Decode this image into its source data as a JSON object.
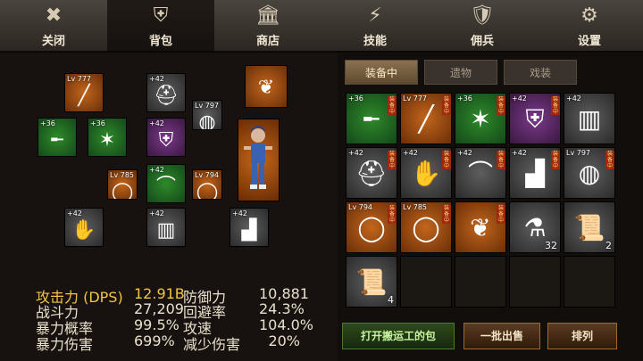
{
  "tabs": [
    {
      "label": "关闭",
      "icon": "close-icon",
      "glyph": "✖"
    },
    {
      "label": "背包",
      "icon": "armor-icon",
      "glyph": "⛨"
    },
    {
      "label": "商店",
      "icon": "bank-icon",
      "glyph": "🏛"
    },
    {
      "label": "技能",
      "icon": "lightning-icon",
      "glyph": "⚡"
    },
    {
      "label": "佣兵",
      "icon": "shield-icon",
      "glyph": "🛡"
    },
    {
      "label": "设置",
      "icon": "gear-icon",
      "glyph": "⚙"
    }
  ],
  "inventory_tabs": [
    "装备中",
    "遗物",
    "戏装"
  ],
  "equipment": [
    {
      "lv": "Lv 777",
      "icon": "staff-icon",
      "glyph": "╱",
      "color": "orange"
    },
    {
      "lv": "+42",
      "icon": "helmet-icon",
      "glyph": "⛑",
      "color": "gray"
    },
    {
      "lv": "",
      "icon": "wings-icon",
      "glyph": "❦",
      "color": "orange"
    },
    {
      "lv": "+36",
      "icon": "gun-icon",
      "glyph": "╾",
      "color": "green"
    },
    {
      "lv": "+36",
      "icon": "mace-icon",
      "glyph": "✶",
      "color": "green"
    },
    {
      "lv": "+42",
      "icon": "chest-armor-icon",
      "glyph": "⛨",
      "color": "purple"
    },
    {
      "lv": "Lv 797",
      "icon": "bracer-icon",
      "glyph": "◍",
      "color": "gray"
    },
    {
      "lv": "Lv 785",
      "icon": "ring-icon",
      "glyph": "◯",
      "color": "orange"
    },
    {
      "lv": "+42",
      "icon": "shoulder-icon",
      "glyph": "⌒",
      "color": "green"
    },
    {
      "lv": "Lv 794",
      "icon": "ring-icon",
      "glyph": "◯",
      "color": "orange"
    },
    {
      "lv": "+42",
      "icon": "gauntlet-icon",
      "glyph": "✋",
      "color": "gray"
    },
    {
      "lv": "+42",
      "icon": "leg-armor-icon",
      "glyph": "▥",
      "color": "gray"
    },
    {
      "lv": "+42",
      "icon": "boots-icon",
      "glyph": "▟",
      "color": "gray"
    }
  ],
  "inventory": [
    {
      "lv": "+36",
      "icon": "gun-icon",
      "glyph": "╾",
      "color": "green",
      "equipped": "装备中",
      "count": ""
    },
    {
      "lv": "Lv 777",
      "icon": "staff-icon",
      "glyph": "╱",
      "color": "orange",
      "equipped": "装备中",
      "count": ""
    },
    {
      "lv": "+36",
      "icon": "mace-icon",
      "glyph": "✶",
      "color": "green",
      "equipped": "装备中",
      "count": ""
    },
    {
      "lv": "+42",
      "icon": "chest-armor-icon",
      "glyph": "⛨",
      "color": "purple",
      "equipped": "装备中",
      "count": ""
    },
    {
      "lv": "+42",
      "icon": "leg-armor-icon",
      "glyph": "▥",
      "color": "gray",
      "equipped": "",
      "count": ""
    },
    {
      "lv": "+42",
      "icon": "helmet-icon",
      "glyph": "⛑",
      "color": "gray",
      "equipped": "装备中",
      "count": ""
    },
    {
      "lv": "+42",
      "icon": "gauntlet-icon",
      "glyph": "✋",
      "color": "gray",
      "equipped": "装备中",
      "count": ""
    },
    {
      "lv": "+42",
      "icon": "shoulder-icon",
      "glyph": "⌒",
      "color": "gray",
      "equipped": "装备中",
      "count": ""
    },
    {
      "lv": "+42",
      "icon": "boots-icon",
      "glyph": "▟",
      "color": "gray",
      "equipped": "装备中",
      "count": ""
    },
    {
      "lv": "Lv 797",
      "icon": "bracer-icon",
      "glyph": "◍",
      "color": "gray",
      "equipped": "装备中",
      "count": ""
    },
    {
      "lv": "Lv 794",
      "icon": "ring-icon",
      "glyph": "◯",
      "color": "orange",
      "equipped": "装备中",
      "count": ""
    },
    {
      "lv": "Lv 785",
      "icon": "ring-icon",
      "glyph": "◯",
      "color": "orange",
      "equipped": "装备中",
      "count": ""
    },
    {
      "lv": "",
      "icon": "wings-icon",
      "glyph": "❦",
      "color": "orange",
      "equipped": "装备中",
      "count": ""
    },
    {
      "lv": "",
      "icon": "potion-icon",
      "glyph": "⚗",
      "color": "gray",
      "equipped": "",
      "count": "32"
    },
    {
      "lv": "",
      "icon": "scroll-icon",
      "glyph": "📜",
      "color": "gray",
      "equipped": "",
      "count": "2"
    },
    {
      "lv": "",
      "icon": "scroll-icon",
      "glyph": "📜",
      "color": "gray",
      "equipped": "",
      "count": "4"
    }
  ],
  "stats": {
    "attack_label": "攻击力 (DPS)",
    "attack_value": "12.91B",
    "power_label": "战斗力",
    "power_value": "27,209",
    "crit_rate_label": "暴力概率",
    "crit_rate_value": "99.5%",
    "crit_dmg_label": "暴力伤害",
    "crit_dmg_value": "699%",
    "defense_label": "防御力",
    "defense_value": "10,881",
    "evasion_label": "回避率",
    "evasion_value": "24.3%",
    "speed_label": "攻速",
    "speed_value": "104.0%",
    "dmg_reduce_label": "减少伤害",
    "dmg_reduce_value": "20%"
  },
  "buttons": {
    "open_porter": "打开搬运工的包",
    "sell_all": "一批出售",
    "sort": "排列"
  },
  "colors": {
    "attack": "#f2c640",
    "equipped_badge": "#a0280e"
  }
}
